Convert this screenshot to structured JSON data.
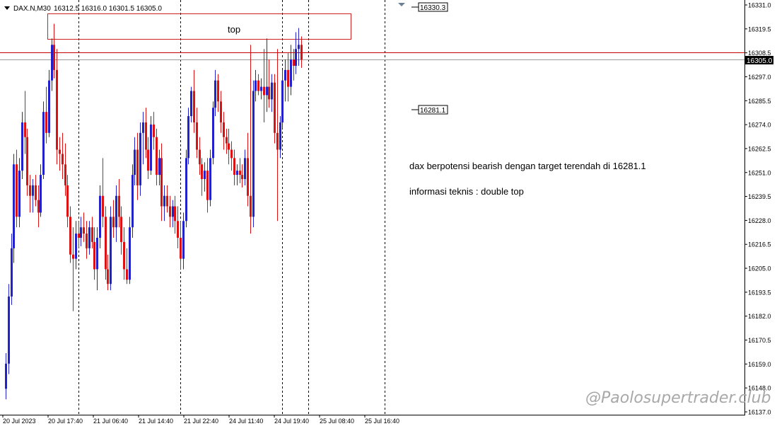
{
  "header": {
    "symbol": "DAX.N,M30",
    "ohlc": "16312.5 16316.0 16301.5 16305.0",
    "dropdown_icon": "triangle-down-icon"
  },
  "annotations": {
    "box_label": "top",
    "note_line1": "dax berpotensi bearish dengan target terendah di 16281.1",
    "note_line2": "informasi teknis : double top",
    "level_high": "16330.3",
    "level_target": "16281.1",
    "current_price": "16305.0",
    "watermark": "@Paolosupertrader.club"
  },
  "colors": {
    "bull": "#2222cc",
    "bear": "#dd1111",
    "box": "#cc2222",
    "price_line": "#c00000",
    "bg": "#ffffff"
  },
  "chart_data": {
    "type": "candlestick",
    "title": "",
    "xlabel": "",
    "ylabel": "",
    "ylim": [
      16137.0,
      16331.0
    ],
    "y_ticks": [
      "16331.0",
      "16319.5",
      "16308.5",
      "16297.0",
      "16285.5",
      "16274.0",
      "16262.5",
      "16251.0",
      "16239.5",
      "16228.0",
      "16216.5",
      "16205.0",
      "16193.5",
      "16182.0",
      "16170.5",
      "16159.0",
      "16148.0",
      "16137.0"
    ],
    "x_labels": [
      "20 Jul 2023",
      "20 Jul 17:40",
      "21 Jul 06:40",
      "21 Jul 14:40",
      "21 Jul 22:40",
      "24 Jul 11:40",
      "24 Jul 19:40",
      "25 Jul 08:40",
      "25 Jul 16:40"
    ],
    "grid": false,
    "separators_at_candle": [
      27,
      65,
      103,
      141
    ],
    "resistance_box": {
      "low": 16315.0,
      "high": 16327.0,
      "label": "top"
    },
    "horizontal_lines": [
      {
        "value": 16308.5,
        "style": "solid",
        "color": "#c00000"
      },
      {
        "value": 16305.0,
        "style": "solid",
        "color": "#999999"
      }
    ],
    "candles": [
      [
        16148,
        16165,
        16143,
        16160
      ],
      [
        16160,
        16198,
        16155,
        16192
      ],
      [
        16192,
        16222,
        16188,
        16215
      ],
      [
        16215,
        16260,
        16208,
        16255
      ],
      [
        16255,
        16262,
        16225,
        16230
      ],
      [
        16230,
        16258,
        16225,
        16252
      ],
      [
        16252,
        16280,
        16248,
        16275
      ],
      [
        16275,
        16290,
        16260,
        16268
      ],
      [
        16268,
        16272,
        16240,
        16245
      ],
      [
        16245,
        16250,
        16232,
        16240
      ],
      [
        16240,
        16248,
        16232,
        16245
      ],
      [
        16245,
        16250,
        16235,
        16238
      ],
      [
        16238,
        16245,
        16225,
        16232
      ],
      [
        16232,
        16255,
        16230,
        16250
      ],
      [
        16250,
        16285,
        16248,
        16280
      ],
      [
        16280,
        16292,
        16265,
        16270
      ],
      [
        16270,
        16300,
        16268,
        16295
      ],
      [
        16295,
        16315,
        16290,
        16312
      ],
      [
        16312,
        16322,
        16296,
        16300
      ],
      [
        16300,
        16310,
        16255,
        16262
      ],
      [
        16262,
        16268,
        16252,
        16260
      ],
      [
        16260,
        16270,
        16248,
        16255
      ],
      [
        16255,
        16265,
        16240,
        16245
      ],
      [
        16245,
        16250,
        16225,
        16230
      ],
      [
        16230,
        16235,
        16208,
        16212
      ],
      [
        16212,
        16225,
        16185,
        16210
      ],
      [
        16210,
        16228,
        16205,
        16222
      ],
      [
        16222,
        16228,
        16215,
        16220
      ],
      [
        16220,
        16230,
        16216,
        16225
      ],
      [
        16225,
        16232,
        16218,
        16222
      ],
      [
        16222,
        16228,
        16210,
        16215
      ],
      [
        16215,
        16228,
        16212,
        16225
      ],
      [
        16225,
        16230,
        16215,
        16218
      ],
      [
        16218,
        16225,
        16200,
        16205
      ],
      [
        16205,
        16225,
        16195,
        16220
      ],
      [
        16220,
        16245,
        16215,
        16240
      ],
      [
        16240,
        16258,
        16225,
        16230
      ],
      [
        16230,
        16235,
        16200,
        16205
      ],
      [
        16205,
        16212,
        16195,
        16198
      ],
      [
        16198,
        16235,
        16195,
        16230
      ],
      [
        16230,
        16238,
        16220,
        16225
      ],
      [
        16225,
        16245,
        16218,
        16240
      ],
      [
        16240,
        16248,
        16225,
        16230
      ],
      [
        16230,
        16235,
        16212,
        16218
      ],
      [
        16218,
        16225,
        16200,
        16205
      ],
      [
        16205,
        16215,
        16198,
        16200
      ],
      [
        16200,
        16230,
        16198,
        16225
      ],
      [
        16225,
        16255,
        16220,
        16250
      ],
      [
        16250,
        16268,
        16245,
        16262
      ],
      [
        16262,
        16270,
        16238,
        16245
      ],
      [
        16245,
        16275,
        16240,
        16270
      ],
      [
        16270,
        16280,
        16255,
        16275
      ],
      [
        16275,
        16282,
        16258,
        16262
      ],
      [
        16262,
        16268,
        16248,
        16252
      ],
      [
        16252,
        16278,
        16250,
        16274
      ],
      [
        16274,
        16280,
        16262,
        16268
      ],
      [
        16268,
        16272,
        16245,
        16250
      ],
      [
        16250,
        16262,
        16245,
        16258
      ],
      [
        16258,
        16265,
        16228,
        16235
      ],
      [
        16235,
        16245,
        16228,
        16240
      ],
      [
        16240,
        16245,
        16232,
        16235
      ],
      [
        16235,
        16240,
        16225,
        16230
      ],
      [
        16230,
        16238,
        16225,
        16235
      ],
      [
        16235,
        16240,
        16222,
        16228
      ],
      [
        16228,
        16235,
        16215,
        16220
      ],
      [
        16220,
        16228,
        16205,
        16210
      ],
      [
        16210,
        16232,
        16205,
        16228
      ],
      [
        16228,
        16262,
        16225,
        16258
      ],
      [
        16258,
        16282,
        16255,
        16278
      ],
      [
        16278,
        16292,
        16275,
        16290
      ],
      [
        16290,
        16300,
        16270,
        16275
      ],
      [
        16275,
        16282,
        16258,
        16262
      ],
      [
        16262,
        16268,
        16250,
        16255
      ],
      [
        16255,
        16258,
        16240,
        16248
      ],
      [
        16248,
        16256,
        16242,
        16252
      ],
      [
        16252,
        16258,
        16232,
        16238
      ],
      [
        16238,
        16262,
        16235,
        16258
      ],
      [
        16258,
        16285,
        16255,
        16282
      ],
      [
        16282,
        16300,
        16278,
        16295
      ],
      [
        16295,
        16298,
        16280,
        16285
      ],
      [
        16285,
        16290,
        16270,
        16275
      ],
      [
        16275,
        16280,
        16262,
        16268
      ],
      [
        16268,
        16272,
        16260,
        16265
      ],
      [
        16265,
        16272,
        16255,
        16262
      ],
      [
        16262,
        16266,
        16252,
        16258
      ],
      [
        16258,
        16262,
        16245,
        16250
      ],
      [
        16250,
        16255,
        16245,
        16252
      ],
      [
        16252,
        16258,
        16246,
        16250
      ],
      [
        16250,
        16255,
        16244,
        16248
      ],
      [
        16248,
        16262,
        16245,
        16258
      ],
      [
        16258,
        16270,
        16235,
        16240
      ],
      [
        16240,
        16312,
        16222,
        16230
      ],
      [
        16230,
        16295,
        16225,
        16290
      ],
      [
        16290,
        16300,
        16285,
        16295
      ],
      [
        16295,
        16298,
        16288,
        16290
      ],
      [
        16290,
        16296,
        16286,
        16292
      ],
      [
        16292,
        16310,
        16275,
        16288
      ],
      [
        16288,
        16315,
        16280,
        16292
      ],
      [
        16292,
        16305,
        16282,
        16286
      ],
      [
        16286,
        16298,
        16280,
        16294
      ],
      [
        16294,
        16298,
        16265,
        16270
      ],
      [
        16270,
        16310,
        16228,
        16262
      ],
      [
        16262,
        16278,
        16258,
        16275
      ],
      [
        16275,
        16300,
        16272,
        16295
      ],
      [
        16295,
        16305,
        16285,
        16300
      ],
      [
        16300,
        16308,
        16285,
        16292
      ],
      [
        16292,
        16312,
        16288,
        16305
      ],
      [
        16305,
        16310,
        16295,
        16302
      ],
      [
        16302,
        16318,
        16298,
        16310
      ],
      [
        16310,
        16320,
        16302,
        16312
      ],
      [
        16312,
        16316,
        16301,
        16305
      ]
    ]
  }
}
